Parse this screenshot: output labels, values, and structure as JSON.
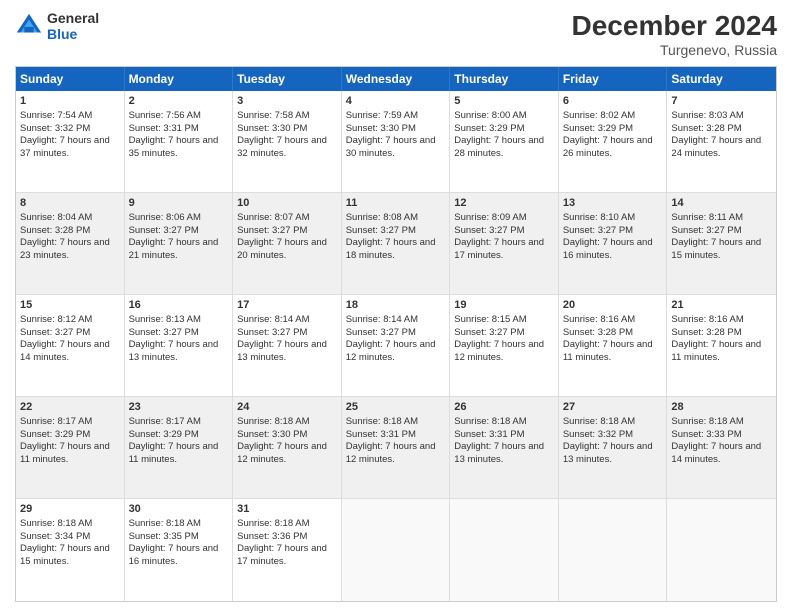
{
  "logo": {
    "line1": "General",
    "line2": "Blue"
  },
  "title": "December 2024",
  "subtitle": "Turgenevo, Russia",
  "headers": [
    "Sunday",
    "Monday",
    "Tuesday",
    "Wednesday",
    "Thursday",
    "Friday",
    "Saturday"
  ],
  "rows": [
    [
      {
        "day": "1",
        "content": "Sunrise: 7:54 AM\nSunset: 3:32 PM\nDaylight: 7 hours and 37 minutes.",
        "shaded": false
      },
      {
        "day": "2",
        "content": "Sunrise: 7:56 AM\nSunset: 3:31 PM\nDaylight: 7 hours and 35 minutes.",
        "shaded": false
      },
      {
        "day": "3",
        "content": "Sunrise: 7:58 AM\nSunset: 3:30 PM\nDaylight: 7 hours and 32 minutes.",
        "shaded": false
      },
      {
        "day": "4",
        "content": "Sunrise: 7:59 AM\nSunset: 3:30 PM\nDaylight: 7 hours and 30 minutes.",
        "shaded": false
      },
      {
        "day": "5",
        "content": "Sunrise: 8:00 AM\nSunset: 3:29 PM\nDaylight: 7 hours and 28 minutes.",
        "shaded": false
      },
      {
        "day": "6",
        "content": "Sunrise: 8:02 AM\nSunset: 3:29 PM\nDaylight: 7 hours and 26 minutes.",
        "shaded": false
      },
      {
        "day": "7",
        "content": "Sunrise: 8:03 AM\nSunset: 3:28 PM\nDaylight: 7 hours and 24 minutes.",
        "shaded": false
      }
    ],
    [
      {
        "day": "8",
        "content": "Sunrise: 8:04 AM\nSunset: 3:28 PM\nDaylight: 7 hours and 23 minutes.",
        "shaded": true
      },
      {
        "day": "9",
        "content": "Sunrise: 8:06 AM\nSunset: 3:27 PM\nDaylight: 7 hours and 21 minutes.",
        "shaded": true
      },
      {
        "day": "10",
        "content": "Sunrise: 8:07 AM\nSunset: 3:27 PM\nDaylight: 7 hours and 20 minutes.",
        "shaded": true
      },
      {
        "day": "11",
        "content": "Sunrise: 8:08 AM\nSunset: 3:27 PM\nDaylight: 7 hours and 18 minutes.",
        "shaded": true
      },
      {
        "day": "12",
        "content": "Sunrise: 8:09 AM\nSunset: 3:27 PM\nDaylight: 7 hours and 17 minutes.",
        "shaded": true
      },
      {
        "day": "13",
        "content": "Sunrise: 8:10 AM\nSunset: 3:27 PM\nDaylight: 7 hours and 16 minutes.",
        "shaded": true
      },
      {
        "day": "14",
        "content": "Sunrise: 8:11 AM\nSunset: 3:27 PM\nDaylight: 7 hours and 15 minutes.",
        "shaded": true
      }
    ],
    [
      {
        "day": "15",
        "content": "Sunrise: 8:12 AM\nSunset: 3:27 PM\nDaylight: 7 hours and 14 minutes.",
        "shaded": false
      },
      {
        "day": "16",
        "content": "Sunrise: 8:13 AM\nSunset: 3:27 PM\nDaylight: 7 hours and 13 minutes.",
        "shaded": false
      },
      {
        "day": "17",
        "content": "Sunrise: 8:14 AM\nSunset: 3:27 PM\nDaylight: 7 hours and 13 minutes.",
        "shaded": false
      },
      {
        "day": "18",
        "content": "Sunrise: 8:14 AM\nSunset: 3:27 PM\nDaylight: 7 hours and 12 minutes.",
        "shaded": false
      },
      {
        "day": "19",
        "content": "Sunrise: 8:15 AM\nSunset: 3:27 PM\nDaylight: 7 hours and 12 minutes.",
        "shaded": false
      },
      {
        "day": "20",
        "content": "Sunrise: 8:16 AM\nSunset: 3:28 PM\nDaylight: 7 hours and 11 minutes.",
        "shaded": false
      },
      {
        "day": "21",
        "content": "Sunrise: 8:16 AM\nSunset: 3:28 PM\nDaylight: 7 hours and 11 minutes.",
        "shaded": false
      }
    ],
    [
      {
        "day": "22",
        "content": "Sunrise: 8:17 AM\nSunset: 3:29 PM\nDaylight: 7 hours and 11 minutes.",
        "shaded": true
      },
      {
        "day": "23",
        "content": "Sunrise: 8:17 AM\nSunset: 3:29 PM\nDaylight: 7 hours and 11 minutes.",
        "shaded": true
      },
      {
        "day": "24",
        "content": "Sunrise: 8:18 AM\nSunset: 3:30 PM\nDaylight: 7 hours and 12 minutes.",
        "shaded": true
      },
      {
        "day": "25",
        "content": "Sunrise: 8:18 AM\nSunset: 3:31 PM\nDaylight: 7 hours and 12 minutes.",
        "shaded": true
      },
      {
        "day": "26",
        "content": "Sunrise: 8:18 AM\nSunset: 3:31 PM\nDaylight: 7 hours and 13 minutes.",
        "shaded": true
      },
      {
        "day": "27",
        "content": "Sunrise: 8:18 AM\nSunset: 3:32 PM\nDaylight: 7 hours and 13 minutes.",
        "shaded": true
      },
      {
        "day": "28",
        "content": "Sunrise: 8:18 AM\nSunset: 3:33 PM\nDaylight: 7 hours and 14 minutes.",
        "shaded": true
      }
    ],
    [
      {
        "day": "29",
        "content": "Sunrise: 8:18 AM\nSunset: 3:34 PM\nDaylight: 7 hours and 15 minutes.",
        "shaded": false
      },
      {
        "day": "30",
        "content": "Sunrise: 8:18 AM\nSunset: 3:35 PM\nDaylight: 7 hours and 16 minutes.",
        "shaded": false
      },
      {
        "day": "31",
        "content": "Sunrise: 8:18 AM\nSunset: 3:36 PM\nDaylight: 7 hours and 17 minutes.",
        "shaded": false
      },
      {
        "day": "",
        "content": "",
        "shaded": false,
        "empty": true
      },
      {
        "day": "",
        "content": "",
        "shaded": false,
        "empty": true
      },
      {
        "day": "",
        "content": "",
        "shaded": false,
        "empty": true
      },
      {
        "day": "",
        "content": "",
        "shaded": false,
        "empty": true
      }
    ]
  ]
}
